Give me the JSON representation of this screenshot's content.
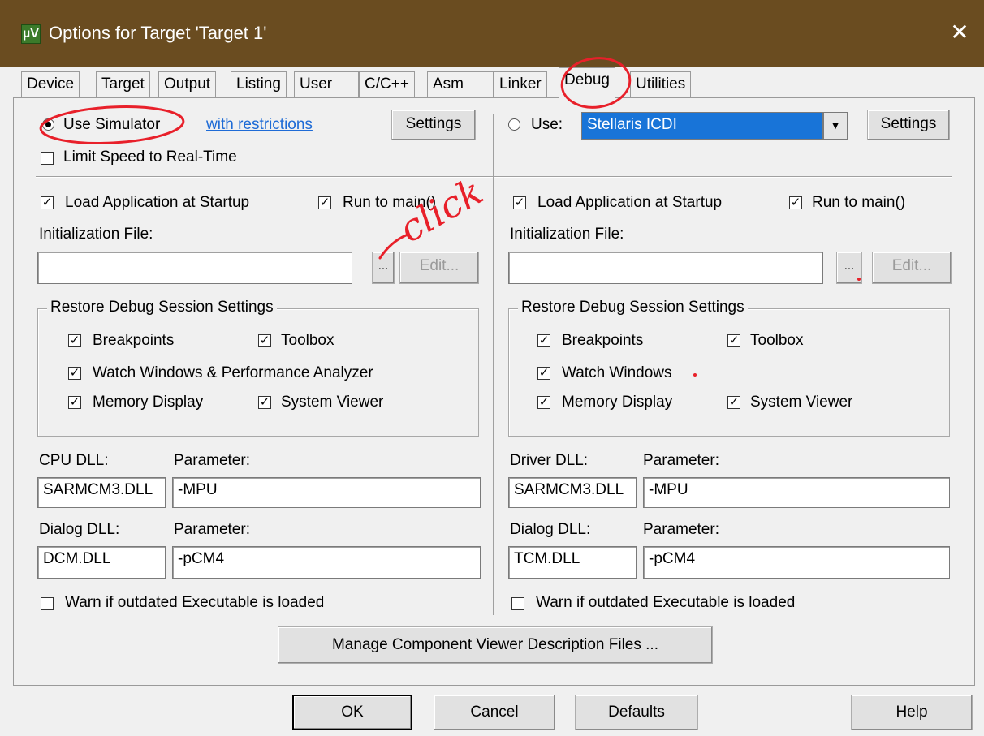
{
  "window": {
    "title": "Options for Target 'Target 1'",
    "close": "✕",
    "app_icon": "µV"
  },
  "tabs": [
    {
      "label": "Device"
    },
    {
      "label": "Target"
    },
    {
      "label": "Output"
    },
    {
      "label": "Listing"
    },
    {
      "label": "User"
    },
    {
      "label": "C/C++"
    },
    {
      "label": "Asm"
    },
    {
      "label": "Linker"
    },
    {
      "label": "Debug"
    },
    {
      "label": "Utilities"
    }
  ],
  "left": {
    "use_simulator": "Use Simulator",
    "with_restrictions": "with restrictions",
    "settings": "Settings",
    "limit_speed": "Limit Speed to Real-Time",
    "load_app": "Load Application at Startup",
    "run_to_main": "Run to main()",
    "init_file_label": "Initialization File:",
    "init_file_value": "",
    "browse": "...",
    "edit": "Edit...",
    "restore_group": "Restore Debug Session Settings",
    "breakpoints": "Breakpoints",
    "toolbox": "Toolbox",
    "watch_windows": "Watch Windows & Performance Analyzer",
    "memory_display": "Memory Display",
    "system_viewer": "System Viewer",
    "cpu_dll_label": "CPU DLL:",
    "cpu_param_label": "Parameter:",
    "cpu_dll": "SARMCM3.DLL",
    "cpu_param": " -MPU",
    "dialog_dll_label": "Dialog DLL:",
    "dialog_param_label": "Parameter:",
    "dialog_dll": "DCM.DLL",
    "dialog_param": "-pCM4",
    "warn_outdated": "Warn if outdated Executable is loaded"
  },
  "right": {
    "use": "Use:",
    "driver": "Stellaris ICDI",
    "dropdown_arrow": "▼",
    "settings": "Settings",
    "load_app": "Load Application at Startup",
    "run_to_main": "Run to main()",
    "init_file_label": "Initialization File:",
    "init_file_value": "",
    "browse": "...",
    "edit": "Edit...",
    "restore_group": "Restore Debug Session Settings",
    "breakpoints": "Breakpoints",
    "toolbox": "Toolbox",
    "watch_windows": "Watch Windows",
    "memory_display": "Memory Display",
    "system_viewer": "System Viewer",
    "driver_dll_label": "Driver DLL:",
    "driver_param_label": "Parameter:",
    "driver_dll": "SARMCM3.DLL",
    "driver_param": "-MPU",
    "dialog_dll_label": "Dialog DLL:",
    "dialog_param_label": "Parameter:",
    "dialog_dll": "TCM.DLL",
    "dialog_param": "-pCM4",
    "warn_outdated": "Warn if outdated Executable is loaded"
  },
  "manage_component": "Manage Component Viewer Description Files ...",
  "footer": {
    "ok": "OK",
    "cancel": "Cancel",
    "defaults": "Defaults",
    "help": "Help"
  },
  "checkmark": "✓",
  "annotation": {
    "text": "click",
    "color": "#e8202a"
  }
}
